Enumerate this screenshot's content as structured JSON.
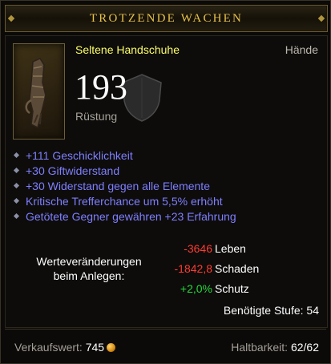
{
  "item": {
    "name": "TROTZENDE WACHEN",
    "type": "Seltene Handschuhe",
    "slot": "Hände",
    "armor_value": "193",
    "armor_label": "Rüstung"
  },
  "affixes": [
    "+111 Geschicklichkeit",
    "+30 Giftwiderstand",
    "+30 Widerstand gegen alle Elemente",
    "Kritische Trefferchance um 5,5% erhöht",
    "Getötete Gegner gewähren +23 Erfahrung"
  ],
  "comparison": {
    "label_line1": "Werteveränderungen",
    "label_line2": "beim Anlegen:",
    "stats": [
      {
        "value": "-3646",
        "label": "Leben",
        "sign": "negative"
      },
      {
        "value": "-1842,8",
        "label": "Schaden",
        "sign": "negative"
      },
      {
        "value": "+2,0%",
        "label": "Schutz",
        "sign": "positive"
      }
    ]
  },
  "requirement": "Benötigte Stufe: 54",
  "footer": {
    "sell_label": "Verkaufswert:",
    "sell_value": "745",
    "durability_label": "Haltbarkeit:",
    "durability_value": "62/62"
  },
  "icons": {
    "item": "glove-icon",
    "armor": "shield-icon",
    "currency": "gold-coin-icon",
    "bullet": "diamond-bullet-icon"
  },
  "colors": {
    "title": "#e8c24a",
    "rare_type": "#ffff66",
    "affix": "#7f7fff",
    "negative": "#ff3b30",
    "positive": "#27d83b"
  }
}
